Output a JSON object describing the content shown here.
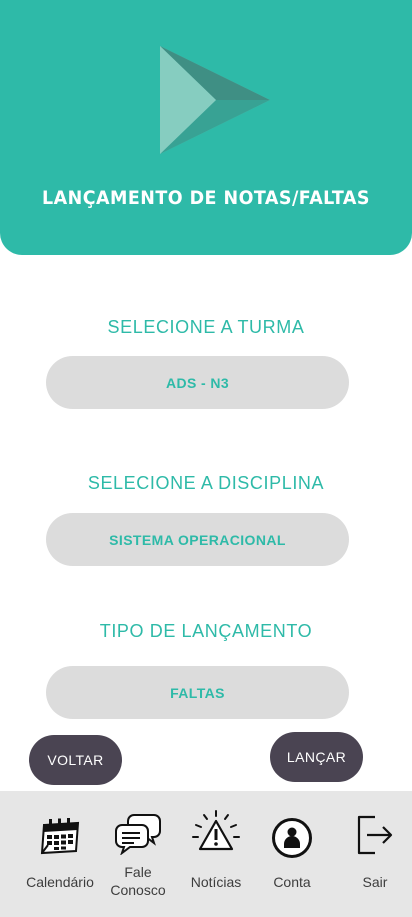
{
  "header": {
    "title": "LANÇAMENTO DE NOTAS/FALTAS",
    "logo_icon": "play-triangle-logo-icon"
  },
  "form": {
    "turma": {
      "label": "SELECIONE A TURMA",
      "value": "ADS - N3"
    },
    "disciplina": {
      "label": "SELECIONE A DISCIPLINA",
      "value": "SISTEMA OPERACIONAL"
    },
    "tipo": {
      "label": "TIPO DE LANÇAMENTO",
      "value": "FALTAS"
    }
  },
  "actions": {
    "back_label": "VOLTAR",
    "submit_label": "LANÇAR"
  },
  "nav": {
    "items": [
      {
        "label": "Calendário",
        "icon": "calendar-icon"
      },
      {
        "label": "Fale\nConosco",
        "icon": "chat-bubbles-icon"
      },
      {
        "label": "Notícias",
        "icon": "alert-notice-icon"
      },
      {
        "label": "Conta",
        "icon": "user-account-icon"
      },
      {
        "label": "Sair",
        "icon": "logout-icon"
      }
    ]
  },
  "colors": {
    "accent": "#2ebaa8",
    "button_dark": "#4a4452",
    "pill_bg": "#dcdcdc",
    "nav_bg": "#e6e6e6"
  }
}
